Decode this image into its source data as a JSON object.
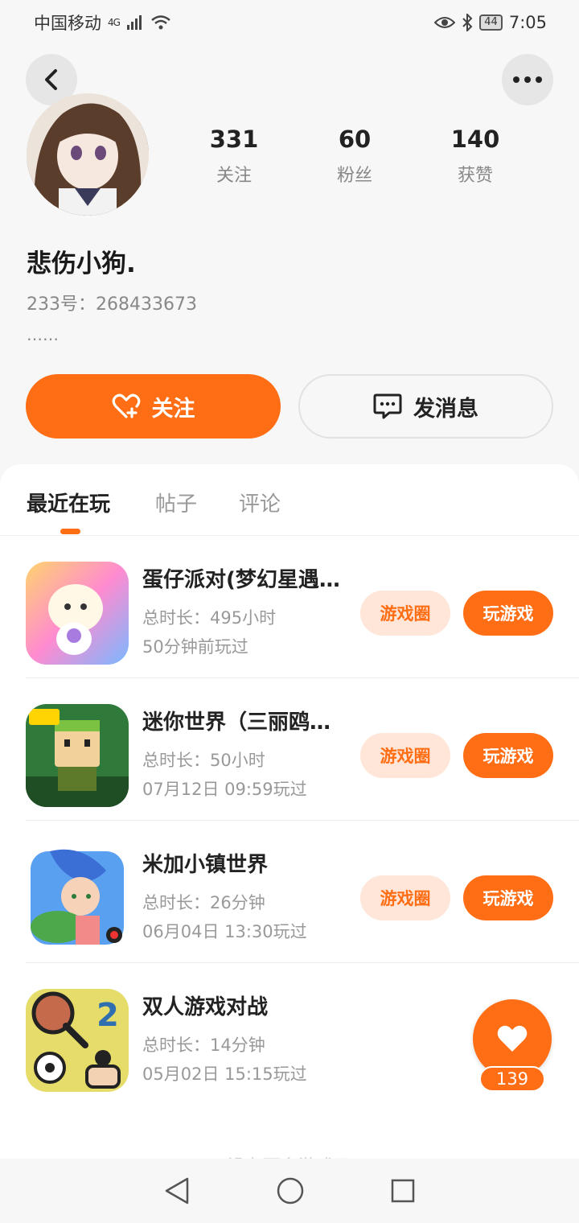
{
  "status_bar": {
    "carrier": "中国移动",
    "network": "4G",
    "battery": "44",
    "time": "7:05"
  },
  "profile": {
    "stats": [
      {
        "value": "331",
        "label": "关注"
      },
      {
        "value": "60",
        "label": "粉丝"
      },
      {
        "value": "140",
        "label": "获赞"
      }
    ],
    "username": "悲伤小狗.",
    "uid": "233号：268433673",
    "bio": "……"
  },
  "actions": {
    "follow_label": "关注",
    "message_label": "发消息"
  },
  "tabs": [
    {
      "label": "最近在玩",
      "active": true
    },
    {
      "label": "帖子",
      "active": false
    },
    {
      "label": "评论",
      "active": false
    }
  ],
  "games": [
    {
      "name": "蛋仔派对(梦幻星遇…",
      "duration": "总时长：495小时",
      "last_played": "50分钟前玩过",
      "circle_label": "游戏圈",
      "play_label": "玩游戏"
    },
    {
      "name": "迷你世界（三丽鸥…",
      "duration": "总时长：50小时",
      "last_played": "07月12日 09:59玩过",
      "circle_label": "游戏圈",
      "play_label": "玩游戏"
    },
    {
      "name": "米加小镇世界",
      "duration": "总时长：26分钟",
      "last_played": "06月04日 13:30玩过",
      "circle_label": "游戏圈",
      "play_label": "玩游戏"
    },
    {
      "name": "双人游戏对战",
      "duration": "总时长：14分钟",
      "last_played": "05月02日 15:15玩过",
      "circle_label": "",
      "play_label": ""
    }
  ],
  "like_fab": {
    "count": "139"
  },
  "footer_hint": "没有更多游戏了",
  "colors": {
    "accent": "#ff6d14",
    "accent_light": "#ffe6d8"
  }
}
